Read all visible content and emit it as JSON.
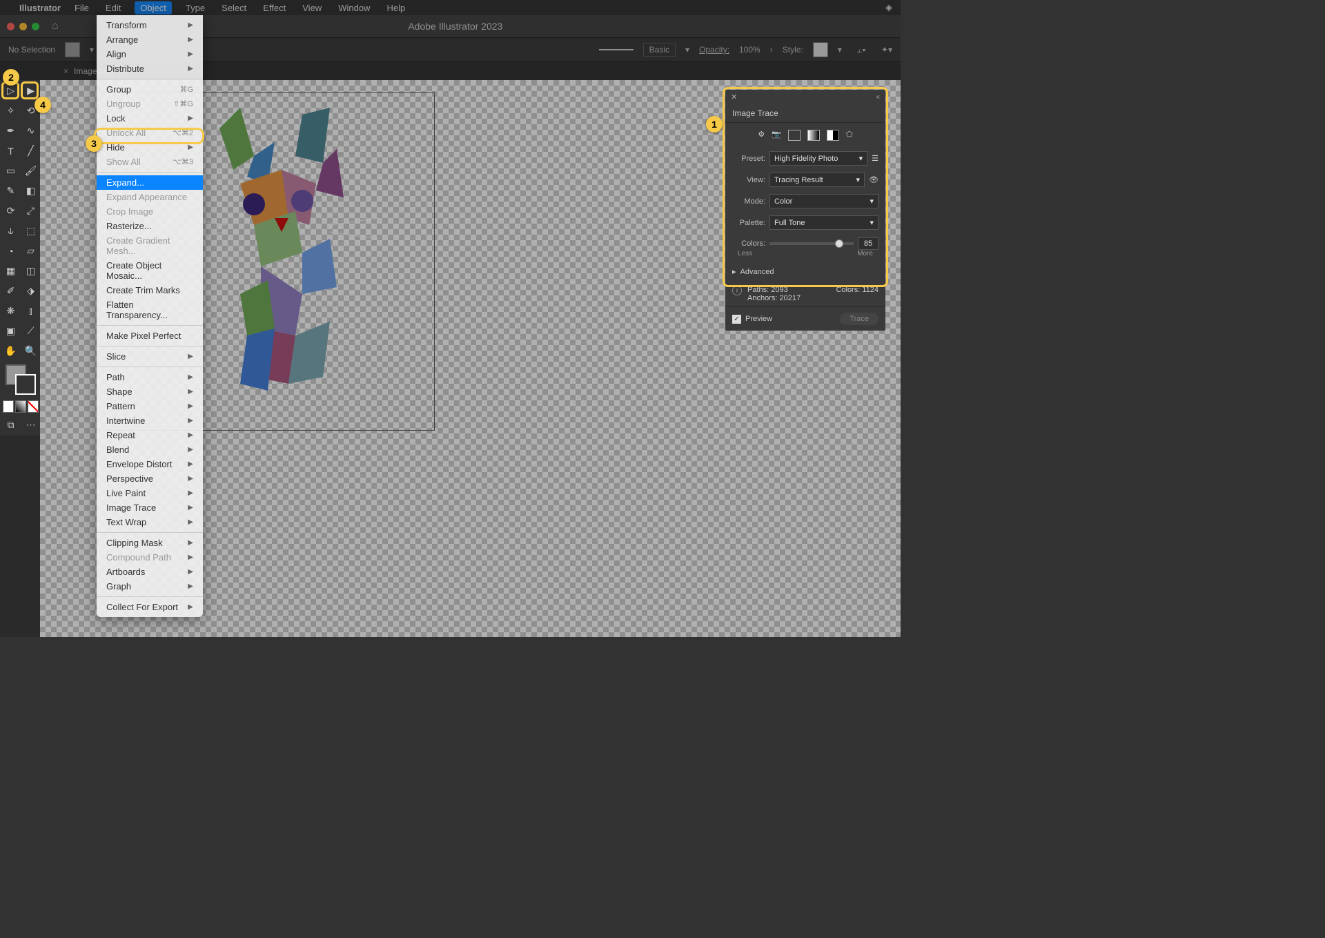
{
  "mac_menu": {
    "app": "Illustrator",
    "items": [
      "File",
      "Edit",
      "Object",
      "Type",
      "Select",
      "Effect",
      "View",
      "Window",
      "Help"
    ],
    "active": "Object"
  },
  "window": {
    "title": "Adobe Illustrator 2023"
  },
  "control_bar": {
    "selection": "No Selection",
    "stroke_style": "Basic",
    "opacity_label": "Opacity:",
    "opacity_value": "100%",
    "style_label": "Style:"
  },
  "tab": {
    "close": "×",
    "name": "Image.png* @"
  },
  "dropdown": {
    "items": [
      {
        "label": "Transform",
        "arrow": true
      },
      {
        "label": "Arrange",
        "arrow": true
      },
      {
        "label": "Align",
        "arrow": true
      },
      {
        "label": "Distribute",
        "arrow": true
      },
      {
        "sep": true
      },
      {
        "label": "Group",
        "shortcut": "⌘G"
      },
      {
        "label": "Ungroup",
        "shortcut": "⇧⌘G",
        "disabled": true
      },
      {
        "label": "Lock",
        "arrow": true
      },
      {
        "label": "Unlock All",
        "shortcut": "⌥⌘2",
        "disabled": true
      },
      {
        "label": "Hide",
        "arrow": true
      },
      {
        "label": "Show All",
        "shortcut": "⌥⌘3",
        "disabled": true
      },
      {
        "sep": true
      },
      {
        "label": "Expand...",
        "highlighted": true
      },
      {
        "label": "Expand Appearance",
        "disabled": true
      },
      {
        "label": "Crop Image",
        "disabled": true
      },
      {
        "label": "Rasterize..."
      },
      {
        "label": "Create Gradient Mesh...",
        "disabled": true
      },
      {
        "label": "Create Object Mosaic..."
      },
      {
        "label": "Create Trim Marks"
      },
      {
        "label": "Flatten Transparency..."
      },
      {
        "sep": true
      },
      {
        "label": "Make Pixel Perfect"
      },
      {
        "sep": true
      },
      {
        "label": "Slice",
        "arrow": true
      },
      {
        "sep": true
      },
      {
        "label": "Path",
        "arrow": true
      },
      {
        "label": "Shape",
        "arrow": true
      },
      {
        "label": "Pattern",
        "arrow": true
      },
      {
        "label": "Intertwine",
        "arrow": true
      },
      {
        "label": "Repeat",
        "arrow": true
      },
      {
        "label": "Blend",
        "arrow": true
      },
      {
        "label": "Envelope Distort",
        "arrow": true
      },
      {
        "label": "Perspective",
        "arrow": true
      },
      {
        "label": "Live Paint",
        "arrow": true
      },
      {
        "label": "Image Trace",
        "arrow": true
      },
      {
        "label": "Text Wrap",
        "arrow": true
      },
      {
        "sep": true
      },
      {
        "label": "Clipping Mask",
        "arrow": true
      },
      {
        "label": "Compound Path",
        "arrow": true,
        "disabled": true
      },
      {
        "label": "Artboards",
        "arrow": true
      },
      {
        "label": "Graph",
        "arrow": true
      },
      {
        "sep": true
      },
      {
        "label": "Collect For Export",
        "arrow": true
      }
    ]
  },
  "trace_panel": {
    "title": "Image Trace",
    "preset_label": "Preset:",
    "preset_value": "High Fidelity Photo",
    "view_label": "View:",
    "view_value": "Tracing Result",
    "mode_label": "Mode:",
    "mode_value": "Color",
    "palette_label": "Palette:",
    "palette_value": "Full Tone",
    "colors_label": "Colors:",
    "colors_value": "85",
    "less": "Less",
    "more": "More",
    "advanced": "Advanced",
    "paths_label": "Paths:",
    "paths_value": "2093",
    "colors_stat_label": "Colors:",
    "colors_stat_value": "1124",
    "anchors_label": "Anchors:",
    "anchors_value": "20217",
    "preview": "Preview",
    "trace_btn": "Trace"
  },
  "badges": {
    "b1": "1",
    "b2": "2",
    "b3": "3",
    "b4": "4"
  }
}
